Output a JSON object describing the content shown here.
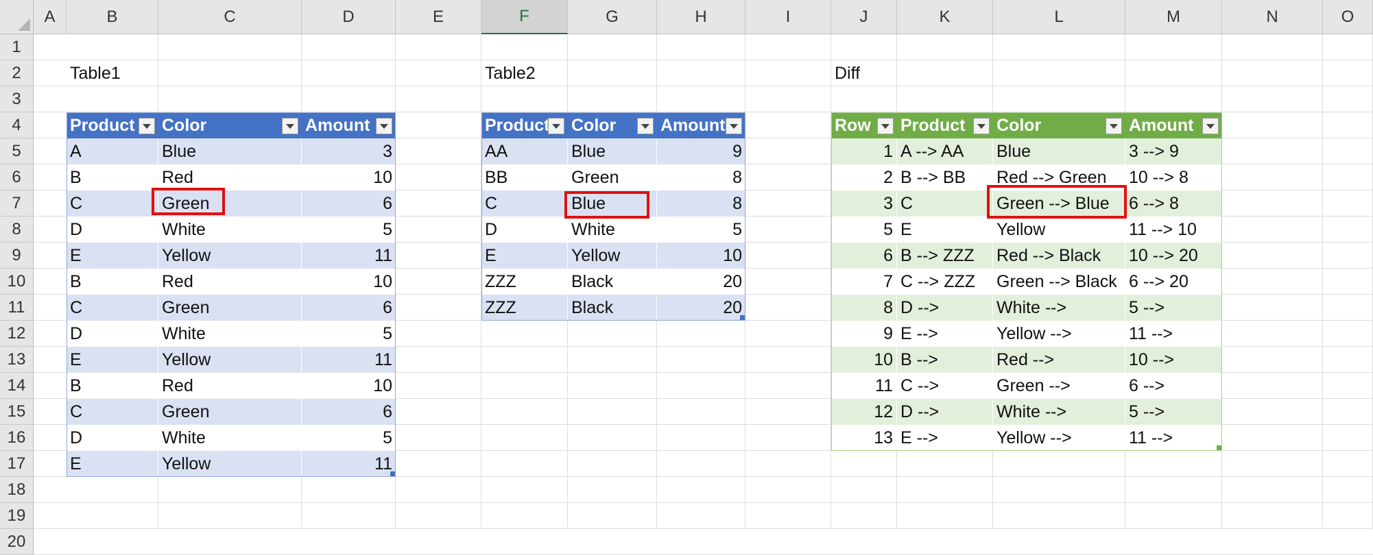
{
  "columns": [
    "A",
    "B",
    "C",
    "D",
    "E",
    "F",
    "G",
    "H",
    "I",
    "J",
    "K",
    "L",
    "M",
    "N",
    "O"
  ],
  "rows": [
    "1",
    "2",
    "3",
    "4",
    "5",
    "6",
    "7",
    "8",
    "9",
    "10",
    "11",
    "12",
    "13",
    "14",
    "15",
    "16",
    "17",
    "18",
    "19",
    "20"
  ],
  "selected_column": "F",
  "table1": {
    "title": "Table1",
    "headers": [
      "Product",
      "Color",
      "Amount"
    ],
    "rows": [
      [
        "A",
        "Blue",
        "3"
      ],
      [
        "B",
        "Red",
        "10"
      ],
      [
        "C",
        "Green",
        "6"
      ],
      [
        "D",
        "White",
        "5"
      ],
      [
        "E",
        "Yellow",
        "11"
      ],
      [
        "B",
        "Red",
        "10"
      ],
      [
        "C",
        "Green",
        "6"
      ],
      [
        "D",
        "White",
        "5"
      ],
      [
        "E",
        "Yellow",
        "11"
      ],
      [
        "B",
        "Red",
        "10"
      ],
      [
        "C",
        "Green",
        "6"
      ],
      [
        "D",
        "White",
        "5"
      ],
      [
        "E",
        "Yellow",
        "11"
      ]
    ]
  },
  "table2": {
    "title": "Table2",
    "headers": [
      "Product",
      "Color",
      "Amount"
    ],
    "rows": [
      [
        "AA",
        "Blue",
        "9"
      ],
      [
        "BB",
        "Green",
        "8"
      ],
      [
        "C",
        "Blue",
        "8"
      ],
      [
        "D",
        "White",
        "5"
      ],
      [
        "E",
        "Yellow",
        "10"
      ],
      [
        "ZZZ",
        "Black",
        "20"
      ],
      [
        "ZZZ",
        "Black",
        "20"
      ]
    ]
  },
  "table3": {
    "title": "Diff",
    "headers": [
      "Row",
      "Product",
      "Color",
      "Amount"
    ],
    "rows": [
      [
        "1",
        "A --> AA",
        "Blue",
        "3 --> 9"
      ],
      [
        "2",
        "B --> BB",
        "Red --> Green",
        "10 --> 8"
      ],
      [
        "3",
        "C",
        "Green --> Blue",
        "6 --> 8"
      ],
      [
        "5",
        "E",
        "Yellow",
        "11 --> 10"
      ],
      [
        "6",
        "B --> ZZZ",
        "Red --> Black",
        "10 --> 20"
      ],
      [
        "7",
        "C --> ZZZ",
        "Green --> Black",
        "6 --> 20"
      ],
      [
        "8",
        "D -->",
        "White -->",
        "5 -->"
      ],
      [
        "9",
        "E -->",
        "Yellow -->",
        "11 -->"
      ],
      [
        "10",
        "B -->",
        "Red -->",
        "10 -->"
      ],
      [
        "11",
        "C -->",
        "Green -->",
        "6 -->"
      ],
      [
        "12",
        "D -->",
        "White -->",
        "5 -->"
      ],
      [
        "13",
        "E -->",
        "Yellow -->",
        "11 -->"
      ]
    ]
  },
  "colors": {
    "blue_header": "#4472c4",
    "blue_band": "#d9e1f2",
    "green_header": "#70ad47",
    "green_band": "#e2efda",
    "highlight": "#e01010"
  }
}
